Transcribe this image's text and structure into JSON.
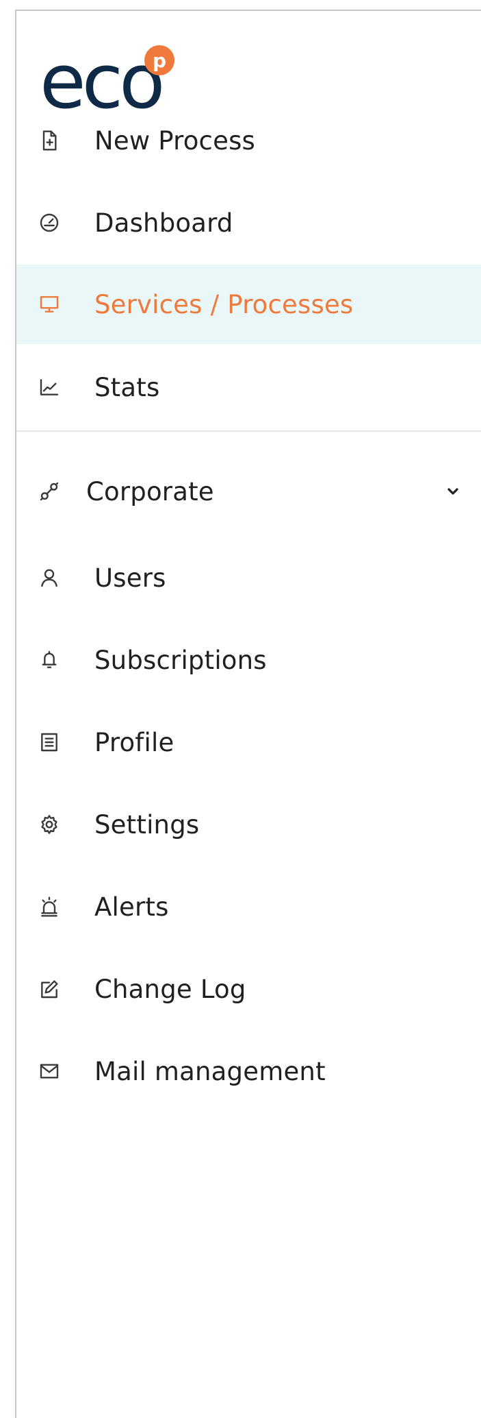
{
  "brand": {
    "logo_text": "eco",
    "logo_badge": "p",
    "primary_color": "#0e2a47",
    "accent_color": "#ef7a3c"
  },
  "menu": {
    "primary": [
      {
        "label": "New Process",
        "icon": "file-plus-icon"
      },
      {
        "label": "Dashboard",
        "icon": "gauge-icon"
      },
      {
        "label": "Services / Processes",
        "icon": "monitor-icon",
        "active": true
      },
      {
        "label": "Stats",
        "icon": "line-chart-icon"
      }
    ],
    "corporate": {
      "label": "Corporate",
      "icon": "link-icon",
      "expand_icon": "chevron-down-icon"
    },
    "secondary": [
      {
        "label": "Users",
        "icon": "user-icon"
      },
      {
        "label": "Subscriptions",
        "icon": "bell-icon"
      },
      {
        "label": "Profile",
        "icon": "profile-card-icon"
      },
      {
        "label": "Settings",
        "icon": "gear-icon"
      },
      {
        "label": "Alerts",
        "icon": "alarm-icon"
      },
      {
        "label": "Change Log",
        "icon": "edit-icon"
      },
      {
        "label": "Mail management",
        "icon": "mail-icon"
      }
    ]
  },
  "colors": {
    "active_background": "#eaf7f9",
    "active_text": "#ef7a3c",
    "text": "#202020",
    "border": "#c7c7c7"
  }
}
